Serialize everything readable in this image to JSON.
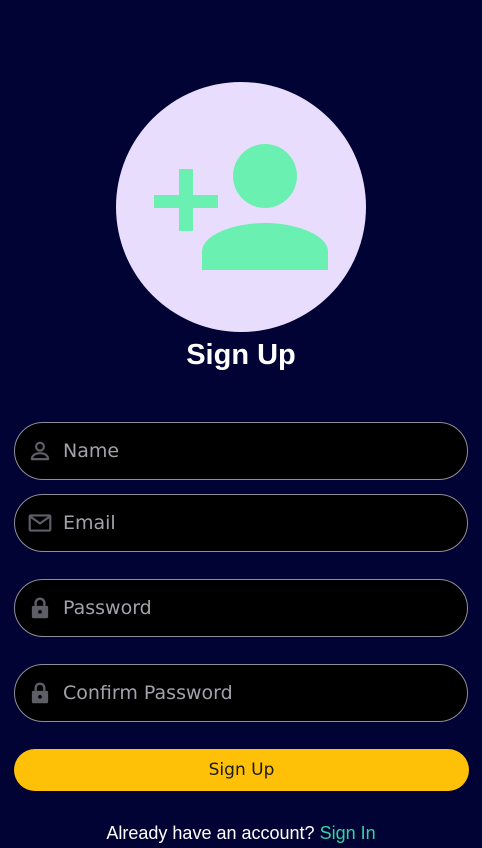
{
  "colors": {
    "background": "#000333",
    "avatar_circle": "#E9DDFD",
    "avatar_glyph": "#6AF0B0",
    "button": "#FFC107",
    "link": "#36D1A1",
    "field_border": "#8E8E96"
  },
  "header": {
    "icon": "add-person-icon",
    "title": "Sign Up"
  },
  "form": {
    "name": {
      "placeholder": "Name",
      "icon": "person-icon",
      "value": ""
    },
    "email": {
      "placeholder": "Email",
      "icon": "mail-icon",
      "value": ""
    },
    "password": {
      "placeholder": "Password",
      "icon": "lock-icon",
      "value": ""
    },
    "confirm_password": {
      "placeholder": "Confirm Password",
      "icon": "lock-icon",
      "value": ""
    },
    "submit_label": "Sign Up"
  },
  "footer": {
    "prompt": "Already have an account?",
    "link_label": "Sign In"
  }
}
